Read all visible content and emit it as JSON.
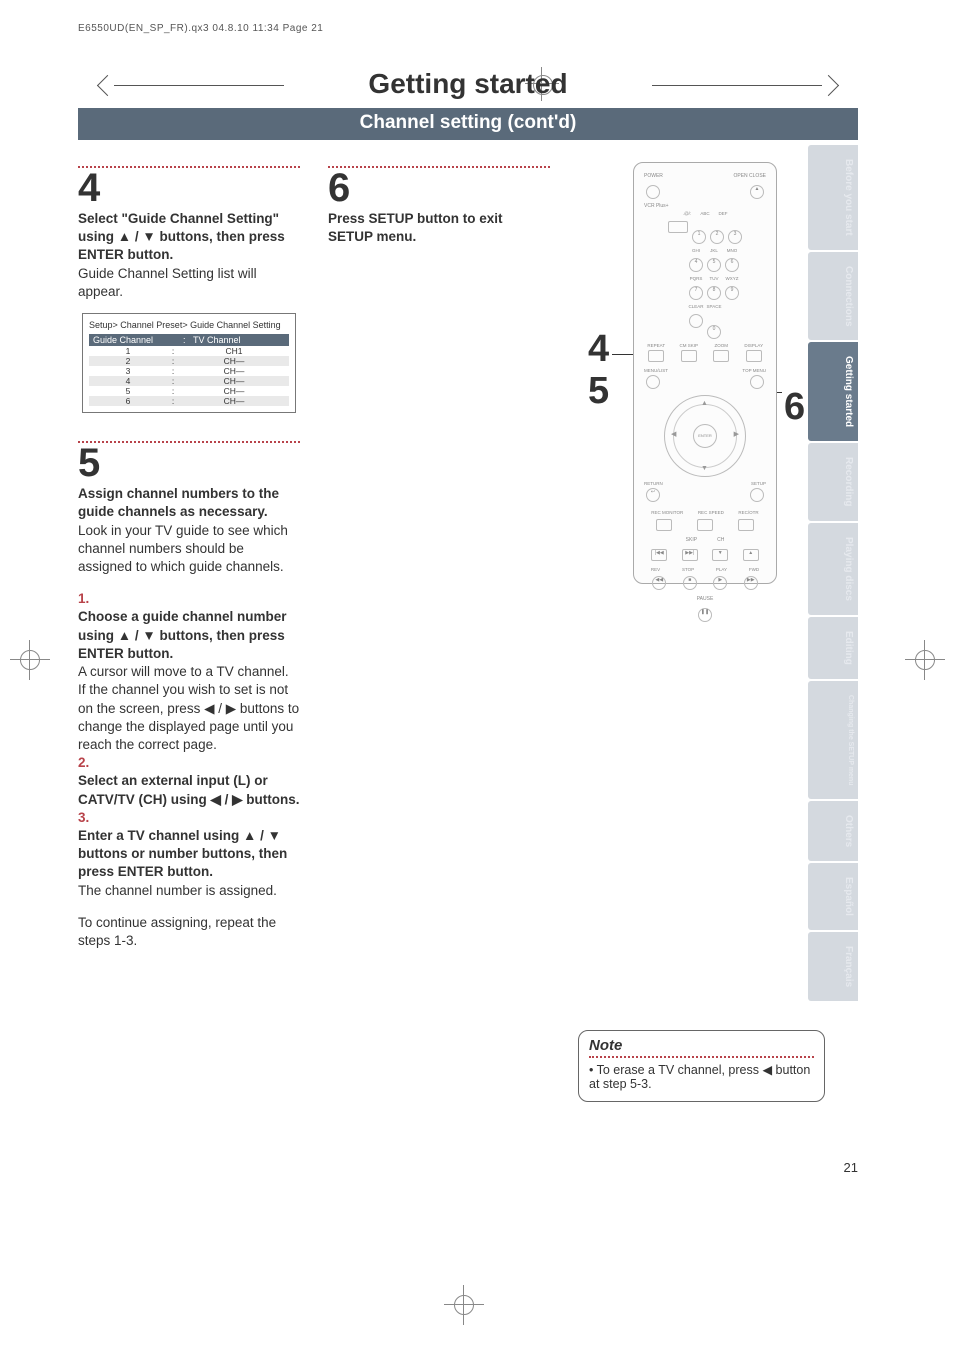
{
  "runhead": "E6550UD(EN_SP_FR).qx3  04.8.10  11:34  Page 21",
  "section": "Getting started",
  "subsection": "Channel setting (cont'd)",
  "step4": {
    "num": "4",
    "bold": "Select \"Guide Channel Setting\" using ▲ / ▼ buttons, then press ENTER button.",
    "text": "Guide Channel Setting list will appear."
  },
  "osd": {
    "title": "Setup> Channel Preset> Guide Channel Setting",
    "head_l": "Guide Channel",
    "head_c": ":",
    "head_r": "TV Channel",
    "rows": [
      {
        "n": "1",
        "c": ":",
        "v": "CH1"
      },
      {
        "n": "2",
        "c": ":",
        "v": "CH—"
      },
      {
        "n": "3",
        "c": ":",
        "v": "CH—"
      },
      {
        "n": "4",
        "c": ":",
        "v": "CH—"
      },
      {
        "n": "5",
        "c": ":",
        "v": "CH—"
      },
      {
        "n": "6",
        "c": ":",
        "v": "CH—"
      }
    ]
  },
  "step5": {
    "num": "5",
    "intro_bold": "Assign channel numbers to the guide channels as necessary.",
    "intro": "Look in your TV guide to see which channel numbers should be assigned to which guide channels.",
    "s1n": "1.",
    "s1b": "Choose a guide channel number using ▲ / ▼ buttons, then press ENTER button.",
    "s1t": "A cursor will move to a TV channel.",
    "s1t2": "If the channel you wish to set is not on the screen, press ◀ / ▶ buttons to change the displayed page until you reach the correct page.",
    "s2n": "2.",
    "s2b": "Select an external input (L) or CATV/TV (CH) using ◀ / ▶ buttons.",
    "s3n": "3.",
    "s3b": "Enter a TV channel using ▲ / ▼ buttons or number buttons, then press ENTER button.",
    "s3t": "The channel number is assigned.",
    "rep": "To continue assigning, repeat the steps 1-3."
  },
  "step6": {
    "num": "6",
    "bold": "Press SETUP button to exit SETUP menu."
  },
  "callouts": {
    "c4": "4",
    "c5": "5",
    "c6": "6"
  },
  "remote": {
    "top_labels": [
      "POWER",
      "OPEN CLOSE"
    ],
    "eject_icon": "eject",
    "vcrplus": "VCR Plus+",
    "keypad_labels": [
      ".@/:",
      "ABC",
      "DEF",
      "GHI",
      "JKL",
      "MNO",
      "PQRS",
      "TUV",
      "WXYZ",
      "CLEAR",
      "SPACE"
    ],
    "keys": [
      "1",
      "2",
      "3",
      "4",
      "5",
      "6",
      "7",
      "8",
      "9",
      "0"
    ],
    "row_labels": [
      "REPEAT",
      "CM SKIP",
      "ZOOM",
      "DISPLAY"
    ],
    "menulist": "MENU/LIST",
    "topmenu": "TOP MENU",
    "dpad_enter": "ENTER",
    "return": "RETURN",
    "setup": "SETUP",
    "rec_row": [
      "REC MONITOR",
      "REC SPEED",
      "REC/OTR"
    ],
    "skip": "SKIP",
    "ch": "CH",
    "transport": [
      "REV",
      "STOP",
      "PLAY",
      "FWD",
      "PAUSE"
    ]
  },
  "note": {
    "title": "Note",
    "body": "• To erase a TV channel, press ◀ button at step 5-3."
  },
  "tabs": [
    "Before you start",
    "Connections",
    "Getting started",
    "Recording",
    "Playing discs",
    "Editing",
    "Changing the SETUP menu",
    "Others",
    "Español",
    "Français"
  ],
  "page_number": "21"
}
